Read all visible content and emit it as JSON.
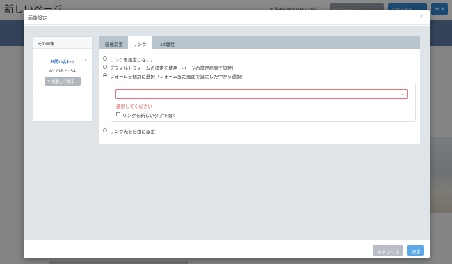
{
  "background": {
    "page_title": "新しいページ",
    "note": "＊ 最後の保存日時ヶ以前",
    "preview_button": "前のバージョン",
    "save_button": "変更を保存",
    "menu_button": "≡ ▾"
  },
  "modal": {
    "title": "画像設定",
    "close_icon": "×",
    "left_panel": {
      "heading": "元の画像",
      "link": "お問い合わせ",
      "chevron": "›",
      "dimensions": "W: 218  H: 54",
      "edit_button": "複製して加工"
    },
    "tabs": [
      {
        "label": "画像変更"
      },
      {
        "label": "リンク"
      },
      {
        "label": "alt属性"
      }
    ],
    "link_options": [
      {
        "label": "リンクを設定しない。"
      },
      {
        "label": "デフォルトフォームの設定を使用（ページの設定画面で設定）"
      },
      {
        "label": "フォームを個別に選択（フォーム設定画面で設定した中から選択）"
      },
      {
        "label": "リンク先を自由に設定"
      }
    ],
    "selected_option_index": 2,
    "form_select": {
      "value": "",
      "chevron": "⌄"
    },
    "error_text": "選択してください",
    "new_tab_label": "リンクを新しいタブで開く",
    "footer": {
      "cancel": "キャンセル",
      "ok": "決定"
    }
  },
  "colors": {
    "accent": "#5aa9e6",
    "error": "#d9534f",
    "tabbar": "#b8c3cc",
    "body_bg": "#dfe4e9"
  }
}
